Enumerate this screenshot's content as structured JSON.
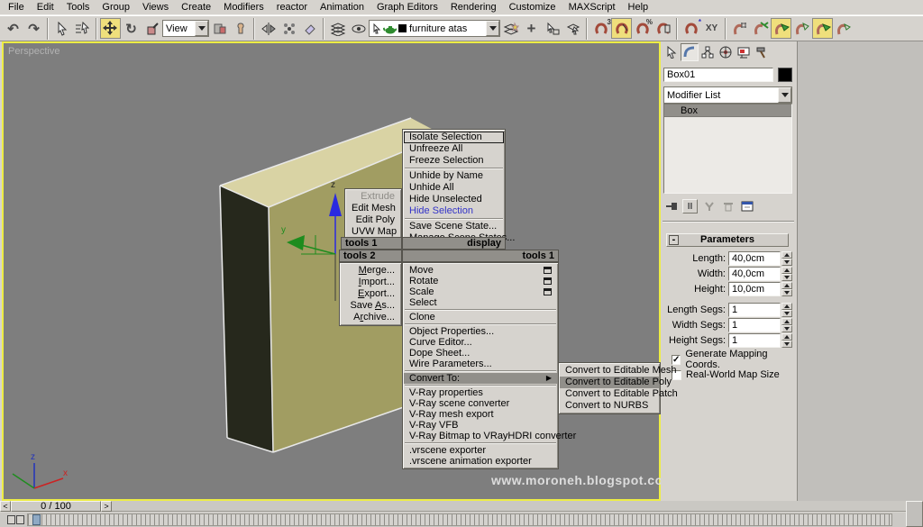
{
  "menu_bar": {
    "items": [
      "File",
      "Edit",
      "Tools",
      "Group",
      "Views",
      "Create",
      "Modifiers",
      "reactor",
      "Animation",
      "Graph Editors",
      "Rendering",
      "Customize",
      "MAXScript",
      "Help"
    ]
  },
  "toolbar": {
    "view_combo": "View",
    "selection_combo": "furniture atas",
    "icons": {
      "undo": "↶",
      "redo": "↷",
      "rotate": "↻",
      "snap3": "3",
      "snap_pct": "%",
      "snap_star": "*",
      "xy": "XY",
      "plus": "+"
    }
  },
  "viewport": {
    "label": "Perspective",
    "watermark": "www.moroneh.blogspot.com",
    "gizmo_z_label": "z",
    "gizmo_y_label": "y",
    "world_axis": {
      "x": "x",
      "z": "z"
    }
  },
  "quad": {
    "tools1_header": "tools 1",
    "display_header": "display",
    "tools2_header": "tools 2",
    "transform_header": "tools 1",
    "submenu_arrow": "▶",
    "tools1_items": [
      "Extrude",
      "Edit Mesh",
      "Edit Poly",
      "UVW Map"
    ],
    "display_items": [
      "Isolate Selection",
      "Unfreeze All",
      "Freeze Selection",
      "Unhide by Name",
      "Unhide All",
      "Hide Unselected",
      "Hide Selection",
      "Save Scene State...",
      "Manage Scene States..."
    ],
    "tools2_items": [
      {
        "pre": "",
        "u": "M",
        "rest": "erge..."
      },
      {
        "pre": "",
        "u": "I",
        "rest": "mport..."
      },
      {
        "pre": "",
        "u": "E",
        "rest": "xport..."
      },
      {
        "pre": "Save ",
        "u": "A",
        "rest": "s..."
      },
      {
        "pre": "A",
        "u": "r",
        "rest": "chive..."
      }
    ],
    "transform_items": [
      "Move",
      "Rotate",
      "Scale",
      "Select",
      "Clone",
      "Object Properties...",
      "Curve Editor...",
      "Dope Sheet...",
      "Wire Parameters...",
      "Convert To:",
      "V-Ray properties",
      "V-Ray scene converter",
      "V-Ray mesh export",
      "V-Ray VFB",
      "V-Ray Bitmap to VRayHDRI converter",
      ".vrscene exporter",
      ".vrscene animation exporter"
    ],
    "convert_items": [
      "Convert to Editable Mesh",
      "Convert to Editable Poly",
      "Convert to Editable Patch",
      "Convert to NURBS"
    ]
  },
  "panel": {
    "object_name": "Box01",
    "modifier_list": "Modifier List",
    "stack_item": "Box",
    "stack_toggle_glyph": "II",
    "rollout_title": "Parameters",
    "rollout_collapse": "-",
    "labels": {
      "length": "Length:",
      "width": "Width:",
      "height": "Height:",
      "length_segs": "Length Segs:",
      "width_segs": "Width Segs:",
      "height_segs": "Height Segs:"
    },
    "values": {
      "length": "40,0cm",
      "width": "40,0cm",
      "height": "10,0cm",
      "length_segs": "1",
      "width_segs": "1",
      "height_segs": "1"
    },
    "checkboxes": {
      "generate": "Generate Mapping Coords.",
      "real_world": "Real-World Map Size",
      "check": "✓"
    }
  },
  "timeline": {
    "frame": "0 / 100",
    "prev": "<",
    "next": ">"
  },
  "colors": {
    "active_viewport_border": "#eded45",
    "viewport_bg": "#7e7e7e",
    "box_top": "#d9d3a4",
    "box_dark_face": "#26281c",
    "box_side": "#a19d62",
    "menu_highlight": "#918f8a",
    "hide_selection_text": "#3434c8",
    "snap_active": "#efdf7c"
  }
}
